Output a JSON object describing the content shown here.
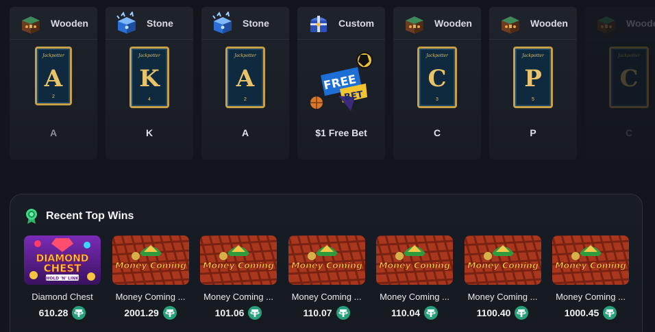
{
  "cards": [
    {
      "type": "Wooden",
      "chest": "wooden-chest",
      "letter": "A",
      "num": "2",
      "label": "A",
      "dim": true,
      "faded": false
    },
    {
      "type": "Stone",
      "chest": "stone-chest",
      "letter": "K",
      "num": "4",
      "label": "K",
      "dim": false,
      "faded": false
    },
    {
      "type": "Stone",
      "chest": "stone-chest",
      "letter": "A",
      "num": "2",
      "label": "A",
      "dim": false,
      "faded": false
    },
    {
      "type": "Custom",
      "chest": "custom-chest",
      "letter": "",
      "num": "",
      "label": "$1 Free Bet",
      "dim": false,
      "faded": false,
      "art": "free-bet"
    },
    {
      "type": "Wooden",
      "chest": "wooden-chest",
      "letter": "C",
      "num": "3",
      "label": "C",
      "dim": false,
      "faded": false
    },
    {
      "type": "Wooden",
      "chest": "wooden-chest",
      "letter": "P",
      "num": "5",
      "label": "P",
      "dim": false,
      "faded": false
    },
    {
      "type": "Wooden",
      "chest": "wooden-chest",
      "letter": "C",
      "num": "",
      "label": "C",
      "dim": true,
      "faded": true
    }
  ],
  "card_brand": "Jackpotter",
  "free_bet_art": {
    "line1": "FREE",
    "line2": "BET"
  },
  "recent_wins": {
    "title": "Recent Top Wins",
    "items": [
      {
        "game": "Diamond Chest",
        "amount": "610.28",
        "thumb": "diamond-chest",
        "thumb_text1": "DIAMOND",
        "thumb_text2": "CHEST",
        "thumb_text3": "HOLD 'N' LINK"
      },
      {
        "game": "Money Coming ...",
        "amount": "2001.29",
        "thumb": "money-coming",
        "thumb_text1": "Money Coming"
      },
      {
        "game": "Money Coming ...",
        "amount": "101.06",
        "thumb": "money-coming",
        "thumb_text1": "Money Coming"
      },
      {
        "game": "Money Coming ...",
        "amount": "110.07",
        "thumb": "money-coming",
        "thumb_text1": "Money Coming"
      },
      {
        "game": "Money Coming ...",
        "amount": "110.04",
        "thumb": "money-coming",
        "thumb_text1": "Money Coming"
      },
      {
        "game": "Money Coming ...",
        "amount": "1100.40",
        "thumb": "money-coming",
        "thumb_text1": "Money Coming"
      },
      {
        "game": "Money Coming ...",
        "amount": "1000.45",
        "thumb": "money-coming",
        "thumb_text1": "Money Coming"
      }
    ]
  },
  "colors": {
    "background": "#12151c",
    "card": "#1f232c",
    "gold": "#c7a047",
    "tether": "#26a17b"
  }
}
